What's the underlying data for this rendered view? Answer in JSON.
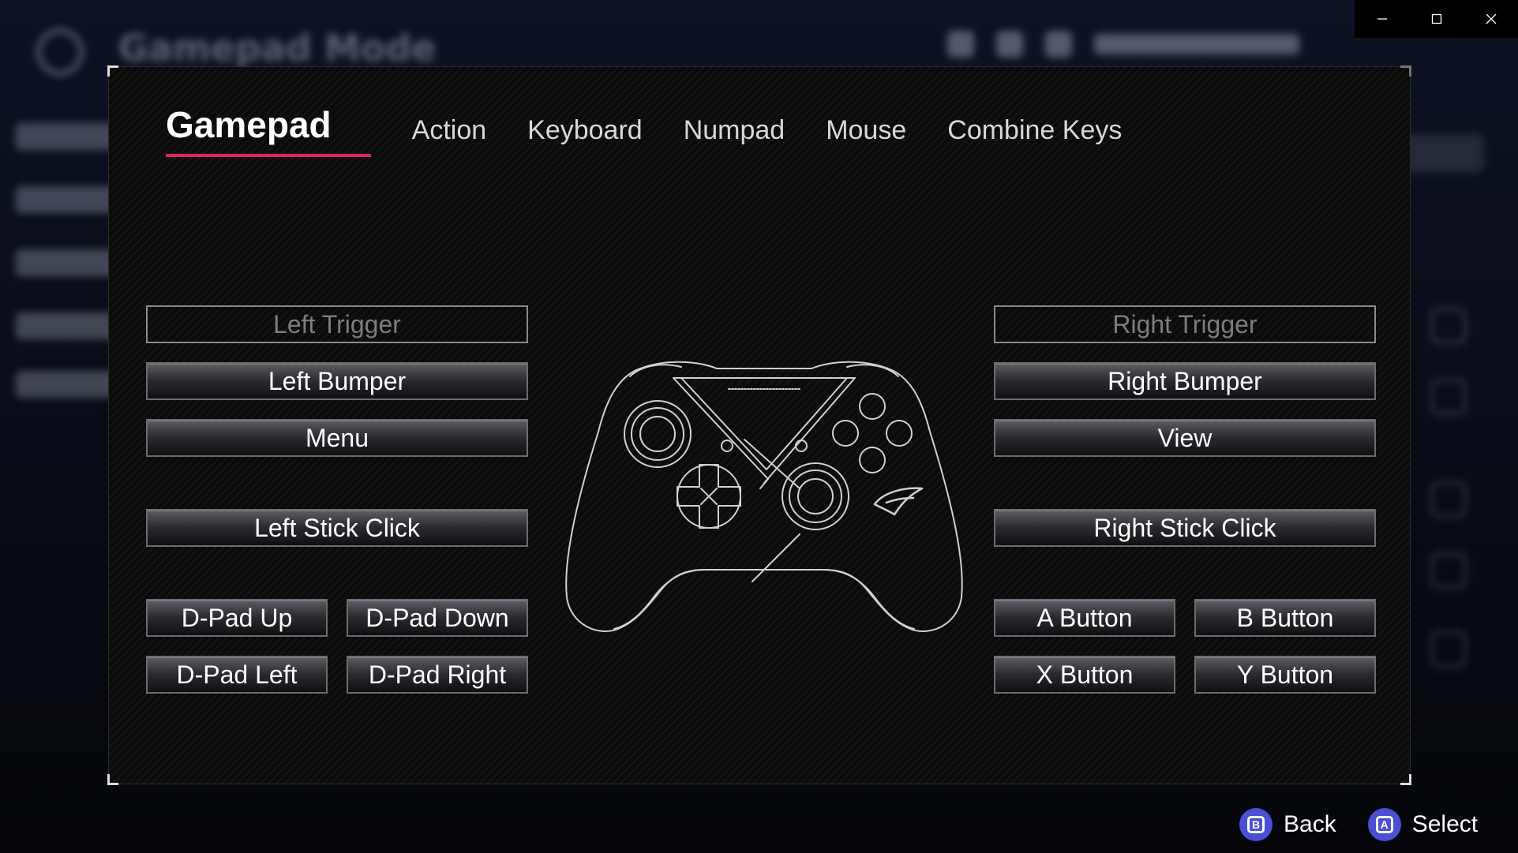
{
  "background": {
    "title": "Gamepad Mode"
  },
  "window": {
    "minimize": "minimize",
    "maximize": "maximize",
    "close": "close"
  },
  "tabs": [
    {
      "label": "Gamepad",
      "active": true
    },
    {
      "label": "Action",
      "active": false
    },
    {
      "label": "Keyboard",
      "active": false
    },
    {
      "label": "Numpad",
      "active": false
    },
    {
      "label": "Mouse",
      "active": false
    },
    {
      "label": "Combine Keys",
      "active": false
    }
  ],
  "left": {
    "left_trigger": "Left Trigger",
    "left_bumper": "Left Bumper",
    "menu": "Menu",
    "left_stick_click": "Left Stick Click",
    "dpad_up": "D-Pad Up",
    "dpad_down": "D-Pad Down",
    "dpad_left": "D-Pad Left",
    "dpad_right": "D-Pad Right"
  },
  "right": {
    "right_trigger": "Right Trigger",
    "right_bumper": "Right Bumper",
    "view": "View",
    "right_stick_click": "Right Stick Click",
    "a_button": "A Button",
    "b_button": "B Button",
    "x_button": "X Button",
    "y_button": "Y Button"
  },
  "hints": {
    "back": {
      "glyph": "B",
      "label": "Back"
    },
    "select": {
      "glyph": "A",
      "label": "Select"
    }
  },
  "colors": {
    "accent": "#e0245e",
    "hint_button": "#4b4fd6"
  }
}
